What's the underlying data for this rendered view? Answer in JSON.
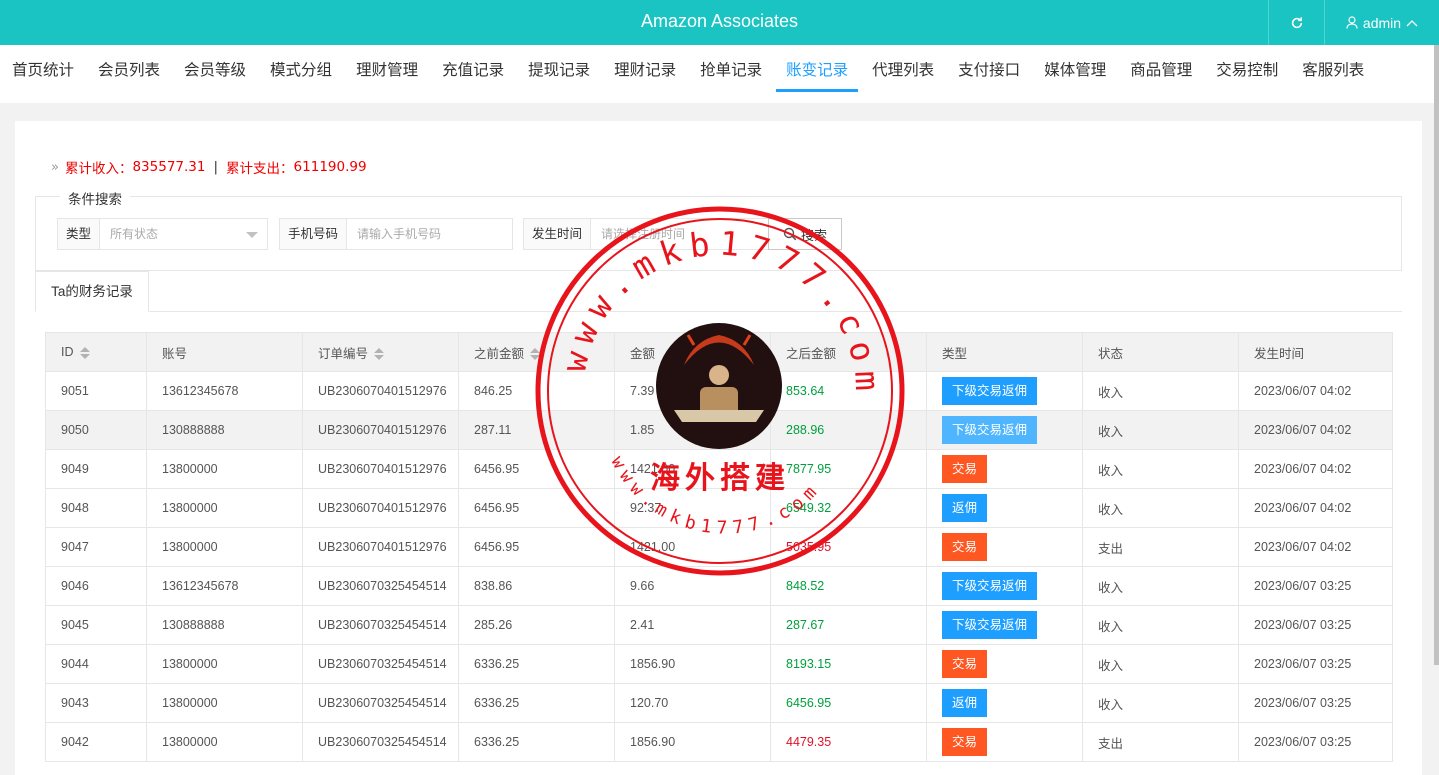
{
  "header": {
    "title": "Amazon Associates",
    "user": "admin"
  },
  "nav": [
    "首页统计",
    "会员列表",
    "会员等级",
    "模式分组",
    "理财管理",
    "充值记录",
    "提现记录",
    "理财记录",
    "抢单记录",
    "账变记录",
    "代理列表",
    "支付接口",
    "媒体管理",
    "商品管理",
    "交易控制",
    "客服列表"
  ],
  "nav_active": "账变记录",
  "summary": {
    "income_label": "累计收入：",
    "income": "835577.31",
    "sep": "|",
    "expense_label": "累计支出：",
    "expense": "611190.99"
  },
  "search": {
    "legend": "条件搜索",
    "type_label": "类型",
    "type_value": "所有状态",
    "phone_label": "手机号码",
    "phone_placeholder": "请输入手机号码",
    "time_label": "发生时间",
    "time_placeholder": "请选择注册时间",
    "button": "搜索"
  },
  "tab": "Ta的财务记录",
  "table": {
    "headers": [
      "ID",
      "账号",
      "订单编号",
      "之前金额",
      "金额",
      "之后金额",
      "类型",
      "状态",
      "发生时间"
    ],
    "rows": [
      {
        "id": "9051",
        "account": "13612345678",
        "order": "UB2306070401512976",
        "before": "846.25",
        "amount": "7.39",
        "after": "853.64",
        "type": "下级交易返佣",
        "status": "收入",
        "time": "2023/06/07 04:02"
      },
      {
        "id": "9050",
        "account": "130888888",
        "order": "UB2306070401512976",
        "before": "287.11",
        "amount": "1.85",
        "after": "288.96",
        "type": "下级交易返佣",
        "status": "收入",
        "time": "2023/06/07 04:02"
      },
      {
        "id": "9049",
        "account": "13800000",
        "order": "UB2306070401512976",
        "before": "6456.95",
        "amount": "1421.00",
        "after": "7877.95",
        "type": "交易",
        "status": "收入",
        "time": "2023/06/07 04:02"
      },
      {
        "id": "9048",
        "account": "13800000",
        "order": "UB2306070401512976",
        "before": "6456.95",
        "amount": "92.37",
        "after": "6549.32",
        "type": "返佣",
        "status": "收入",
        "time": "2023/06/07 04:02"
      },
      {
        "id": "9047",
        "account": "13800000",
        "order": "UB2306070401512976",
        "before": "6456.95",
        "amount": "1421.00",
        "after": "5035.95",
        "type": "交易",
        "status": "支出",
        "time": "2023/06/07 04:02"
      },
      {
        "id": "9046",
        "account": "13612345678",
        "order": "UB2306070325454514",
        "before": "838.86",
        "amount": "9.66",
        "after": "848.52",
        "type": "下级交易返佣",
        "status": "收入",
        "time": "2023/06/07 03:25"
      },
      {
        "id": "9045",
        "account": "130888888",
        "order": "UB2306070325454514",
        "before": "285.26",
        "amount": "2.41",
        "after": "287.67",
        "type": "下级交易返佣",
        "status": "收入",
        "time": "2023/06/07 03:25"
      },
      {
        "id": "9044",
        "account": "13800000",
        "order": "UB2306070325454514",
        "before": "6336.25",
        "amount": "1856.90",
        "after": "8193.15",
        "type": "交易",
        "status": "收入",
        "time": "2023/06/07 03:25"
      },
      {
        "id": "9043",
        "account": "13800000",
        "order": "UB2306070325454514",
        "before": "6336.25",
        "amount": "120.70",
        "after": "6456.95",
        "type": "返佣",
        "status": "收入",
        "time": "2023/06/07 03:25"
      },
      {
        "id": "9042",
        "account": "13800000",
        "order": "UB2306070325454514",
        "before": "6336.25",
        "amount": "1856.90",
        "after": "4479.35",
        "type": "交易",
        "status": "支出",
        "time": "2023/06/07 03:25"
      }
    ]
  },
  "watermark": {
    "outer_text": "www.mkb1777.com",
    "inner_text": "www.mkb1777.com",
    "center_text": "海外搭建"
  },
  "colors": {
    "header": "#1ac4c2",
    "accent": "#1e9fff",
    "orange": "#ff5722",
    "income": "#009f3c",
    "expense": "#e0102a",
    "stamp": "#e8141c"
  }
}
